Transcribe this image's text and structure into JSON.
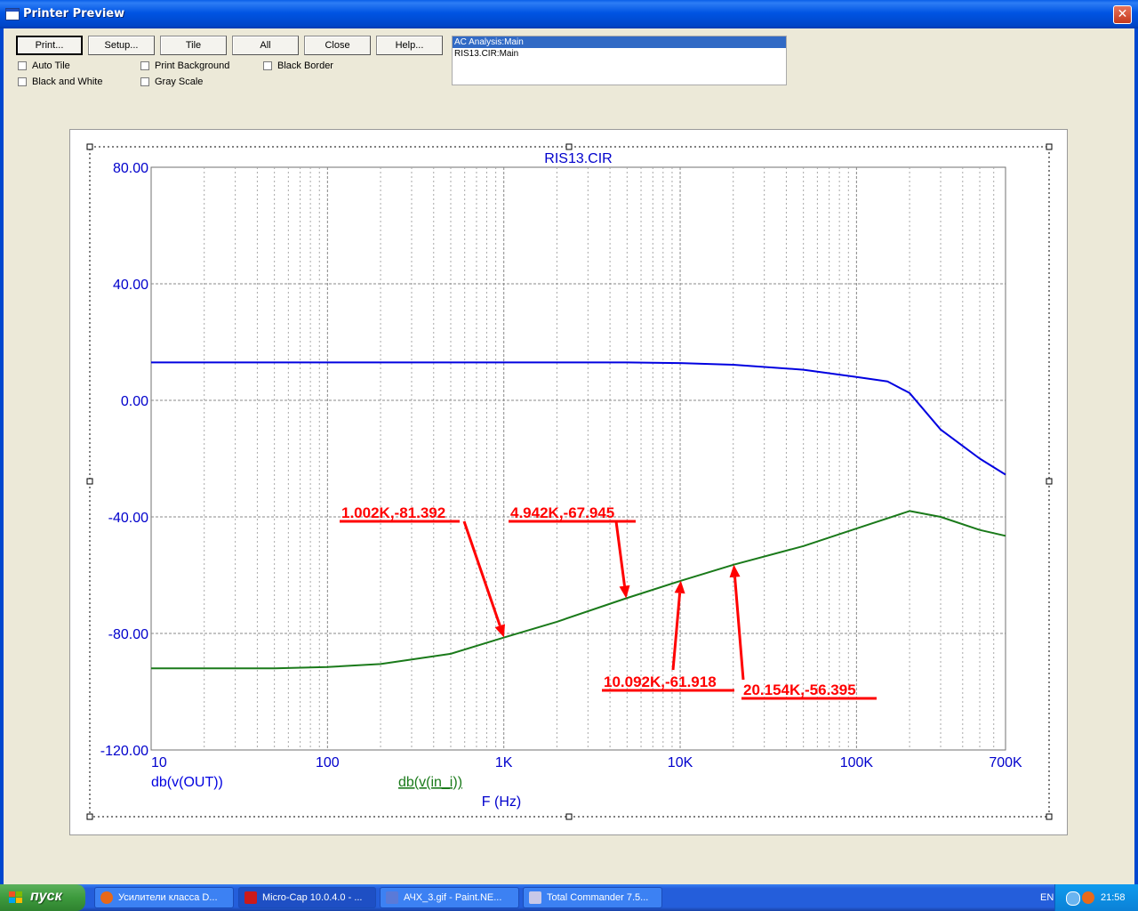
{
  "window": {
    "title": "Printer Preview",
    "close_glyph": "✕"
  },
  "toolbar": {
    "buttons": [
      "Print...",
      "Setup...",
      "Tile",
      "All",
      "Close",
      "Help..."
    ],
    "checkboxes": {
      "auto_tile": "Auto Tile",
      "print_background": "Print Background",
      "black_border": "Black Border",
      "black_and_white": "Black and White",
      "gray_scale": "Gray Scale"
    },
    "analysis_list": [
      {
        "label": "AC Analysis:Main",
        "selected": true
      },
      {
        "label": "RIS13.CIR:Main",
        "selected": false
      }
    ]
  },
  "colors": {
    "axis_blue": "#0000cc",
    "series_out": "#0000e0",
    "series_in": "#1a7a1a",
    "annotation": "#ff0000"
  },
  "chart_data": {
    "type": "line",
    "title": "RIS13.CIR",
    "xlabel": "F (Hz)",
    "x_scale": "log",
    "xlim": [
      10,
      700000
    ],
    "ylim": [
      -120,
      80
    ],
    "grid": true,
    "y_ticks": [
      "80.00",
      "40.00",
      "0.00",
      "-40.00",
      "-80.00",
      "-120.00"
    ],
    "x_ticks": [
      {
        "value": 10,
        "label": "10"
      },
      {
        "value": 100,
        "label": "100"
      },
      {
        "value": 1000,
        "label": "1K"
      },
      {
        "value": 10000,
        "label": "10K"
      },
      {
        "value": 100000,
        "label": "100K"
      },
      {
        "value": 700000,
        "label": "700K"
      }
    ],
    "series": [
      {
        "name": "db(v(OUT))",
        "color": "#0000e0",
        "x": [
          10,
          100,
          1000,
          5000,
          10000,
          20000,
          50000,
          100000,
          150000,
          200000,
          300000,
          500000,
          700000
        ],
        "y": [
          13,
          13,
          13,
          13,
          12.8,
          12.2,
          10.5,
          8,
          6.5,
          2.5,
          -10,
          -20,
          -25.5
        ]
      },
      {
        "name": "db(v(in_i))",
        "color": "#1a7a1a",
        "x": [
          10,
          50,
          100,
          200,
          500,
          1002,
          2000,
          4942,
          10092,
          20154,
          50000,
          100000,
          200000,
          300000,
          500000,
          700000
        ],
        "y": [
          -92,
          -92,
          -91.5,
          -90.5,
          -87,
          -81.392,
          -76,
          -67.945,
          -61.918,
          -56.395,
          -50,
          -44,
          -38,
          -40,
          -44.5,
          -46.5
        ]
      }
    ],
    "annotations": [
      {
        "label": "1.002K,-81.392",
        "x": 1002,
        "y": -81.392
      },
      {
        "label": "4.942K,-67.945",
        "x": 4942,
        "y": -67.945
      },
      {
        "label": "10.092K,-61.918",
        "x": 10092,
        "y": -61.918
      },
      {
        "label": "20.154K,-56.395",
        "x": 20154,
        "y": -56.395
      }
    ]
  },
  "taskbar": {
    "start_label": "пуск",
    "tasks": [
      {
        "label": "Усилители класса D...",
        "icon": "firefox-icon",
        "color": "#e8681a"
      },
      {
        "label": "Micro-Cap 10.0.4.0 - ...",
        "icon": "microcap-icon",
        "color": "#cc1a1a"
      },
      {
        "label": "АЧХ_3.gif - Paint.NE...",
        "icon": "paintnet-icon",
        "color": "#5a7ad8"
      },
      {
        "label": "Total Commander 7.5...",
        "icon": "totalcmd-icon",
        "color": "#c8c8e8"
      }
    ],
    "lang": "EN",
    "clock": "21:58"
  }
}
